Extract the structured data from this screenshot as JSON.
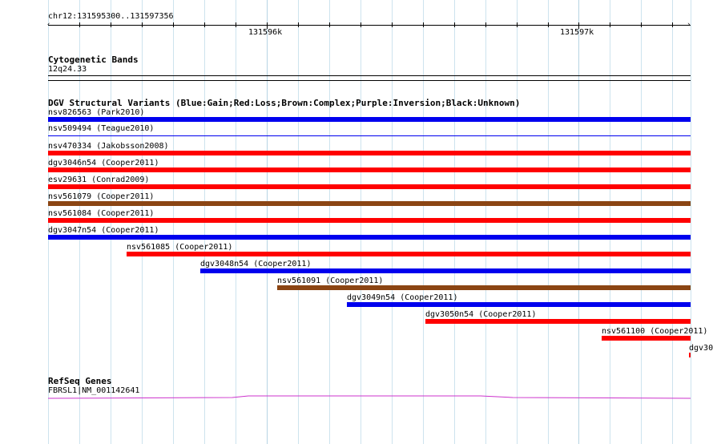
{
  "ruler": {
    "range": "chr12:131595300..131597356",
    "tick_labels": [
      "131596k",
      "131597k"
    ]
  },
  "cyto": {
    "title": "Cytogenetic Bands",
    "band": "12q24.33"
  },
  "dgv": {
    "title": "DGV Structural Variants (Blue:Gain;Red:Loss;Brown:Complex;Purple:Inversion;Black:Unknown)",
    "features": [
      {
        "label": "nsv826563 (Park2010)",
        "type": "Gain",
        "color": "#0000ee"
      },
      {
        "label": "nsv509494 (Teague2010)",
        "type": "Gain",
        "color": "#0000ee"
      },
      {
        "label": "nsv470334 (Jakobsson2008)",
        "type": "Loss",
        "color": "#ff0000"
      },
      {
        "label": "dgv3046n54 (Cooper2011)",
        "type": "Loss",
        "color": "#ff0000"
      },
      {
        "label": "esv29631 (Conrad2009)",
        "type": "Loss",
        "color": "#ff0000"
      },
      {
        "label": "nsv561079 (Cooper2011)",
        "type": "Complex",
        "color": "#8b4513"
      },
      {
        "label": "nsv561084 (Cooper2011)",
        "type": "Loss",
        "color": "#ff0000"
      },
      {
        "label": "dgv3047n54 (Cooper2011)",
        "type": "Gain",
        "color": "#0000ee"
      },
      {
        "label": "nsv561085 (Cooper2011)",
        "type": "Loss",
        "color": "#ff0000"
      },
      {
        "label": "dgv3048n54 (Cooper2011)",
        "type": "Gain",
        "color": "#0000ee"
      },
      {
        "label": "nsv561091 (Cooper2011)",
        "type": "Complex",
        "color": "#8b4513"
      },
      {
        "label": "dgv3049n54 (Cooper2011)",
        "type": "Gain",
        "color": "#0000ee"
      },
      {
        "label": "dgv3050n54 (Cooper2011)",
        "type": "Loss",
        "color": "#ff0000"
      },
      {
        "label": "nsv561100 (Cooper2011)",
        "type": "Loss",
        "color": "#ff0000"
      },
      {
        "label": "dgv30",
        "type": "Loss",
        "color": "#ff0000"
      }
    ]
  },
  "refseq": {
    "title": "RefSeq Genes",
    "gene_label": "FBRSL1|NM_001142641",
    "color": "#cc33cc"
  }
}
